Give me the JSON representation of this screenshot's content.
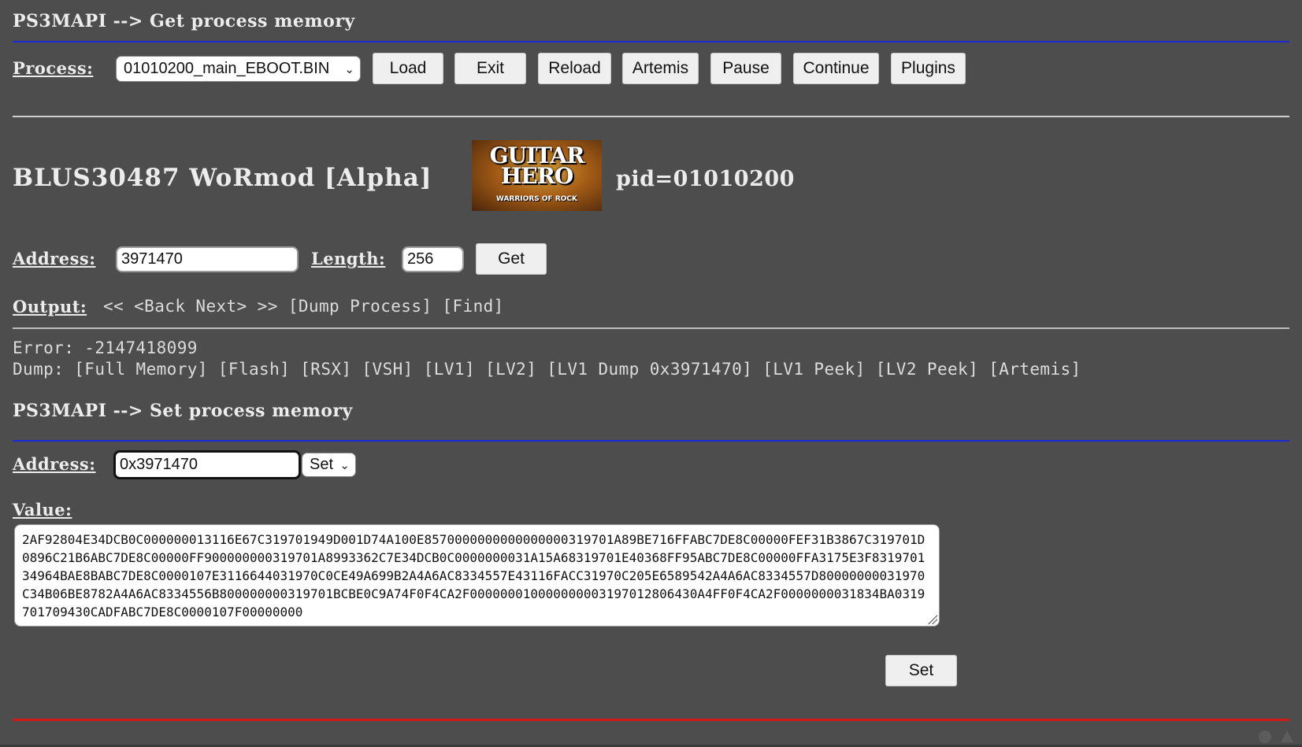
{
  "get_section": {
    "header": "PS3MAPI --> Get process memory",
    "process_label": "Process:",
    "process_selected": "01010200_main_EBOOT.BIN",
    "buttons": [
      "Load",
      "Exit",
      "Reload",
      "Artemis",
      "Pause",
      "Continue",
      "Plugins"
    ]
  },
  "game": {
    "title": "BLUS30487 WoRmod [Alpha]",
    "cover_logo_line1": "GUITAR",
    "cover_logo_line2": "HERO",
    "cover_logo_sub": "WARRIORS OF ROCK",
    "pid": "pid=01010200"
  },
  "query": {
    "address_label": "Address:",
    "address_value": "3971470",
    "length_label": "Length:",
    "length_value": "256",
    "get_button": "Get"
  },
  "output": {
    "label": "Output:",
    "nav_first": "<<",
    "nav_back": "<Back",
    "nav_next": "Next>",
    "nav_last": ">>",
    "dump_process": "[Dump Process]",
    "find": "[Find]"
  },
  "result": {
    "error_line": "Error: -2147418099",
    "dump_label": "Dump:",
    "dump_links": [
      "[Full Memory]",
      "[Flash]",
      "[RSX]",
      "[VSH]",
      "[LV1]",
      "[LV2]",
      "[LV1 Dump 0x3971470]",
      "[LV1 Peek]",
      "[LV2 Peek]",
      "[Artemis]"
    ]
  },
  "set_section": {
    "header": "PS3MAPI --> Set process memory",
    "address_label": "Address:",
    "address_value": "0x3971470",
    "mode_selected": "Set",
    "value_label": "Value:",
    "value_text": "2AF92804E34DCB0C000000013116E67C319701949D001D74A100E8570000000000000000319701A89BE716FFABC7DE8C00000FEF31B3867C319701D0896C21B6ABC7DE8C00000FF900000000319701A8993362C7E34DCB0C0000000031A15A68319701E40368FF95ABC7DE8C00000FFA3175E3F831970134964BAE8BABC7DE8C0000107E3116644031970C0CE49A699B2A4A6AC8334557E43116FACC31970C205E6589542A4A6AC8334557D80000000031970C34B06BE8782A4A6AC8334556B800000000319701BCBE0C9A74F0F4CA2F000000010000000003197012806430A4FF0F4CA2F0000000031834BA0319701709430CADFABC7DE8C0000107F00000000",
    "set_button": "Set"
  }
}
